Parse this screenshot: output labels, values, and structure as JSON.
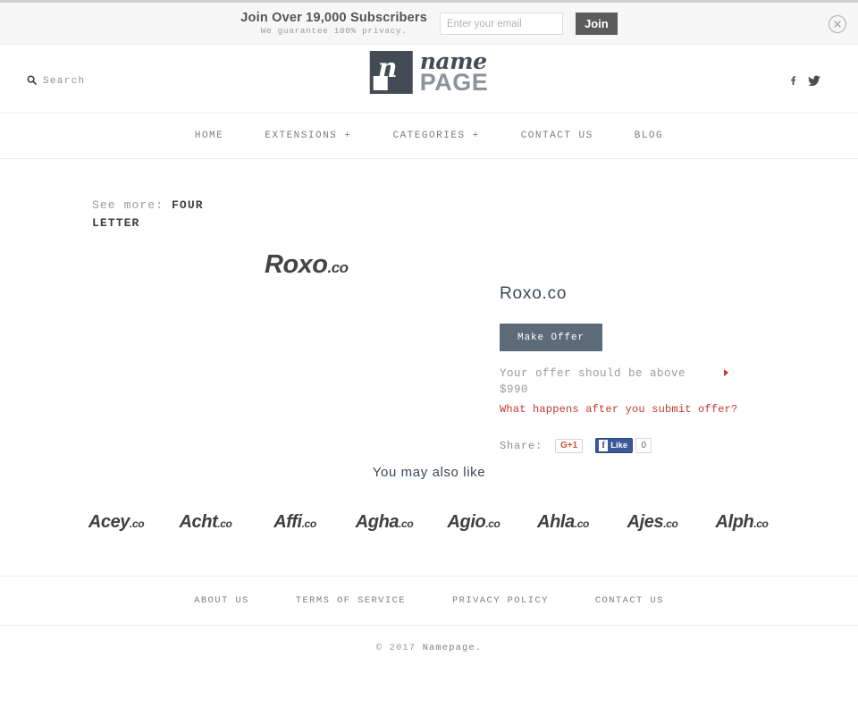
{
  "topbar": {
    "headline": "Join Over 19,000 Subscribers",
    "subline": "We guarantee 100% privacy.",
    "email_placeholder": "Enter your email",
    "email_value": "",
    "join_label": "Join",
    "close_icon": "close-circle-icon"
  },
  "header": {
    "search_label": "Search",
    "search_icon": "search-icon",
    "logo": {
      "mark_letter": "n",
      "name": "name",
      "page": "PAGE"
    },
    "social": [
      {
        "name": "facebook-icon",
        "label": "f"
      },
      {
        "name": "twitter-icon",
        "label": "t"
      }
    ]
  },
  "nav": {
    "items": [
      {
        "label": "HOME"
      },
      {
        "label": "EXTENSIONS +"
      },
      {
        "label": "CATEGORIES +"
      },
      {
        "label": "CONTACT US"
      },
      {
        "label": "BLOG"
      }
    ]
  },
  "breadcrumb": {
    "label": "See more:",
    "link": "FOUR LETTER"
  },
  "product": {
    "logo_name": "Roxo",
    "logo_tld": ".co",
    "title": "Roxo.co",
    "make_offer_label": "Make Offer",
    "offer_note": "Your offer should be above $990",
    "offer_minimum": "$990",
    "offer_link": "What happens after you submit offer?",
    "share_label": "Share:",
    "gplus_label": "G+1",
    "facebook_like_label": "Like",
    "facebook_count": "0"
  },
  "also_like": {
    "title": "You may also like",
    "items": [
      {
        "name": "Acey",
        "tld": ".co"
      },
      {
        "name": "Acht",
        "tld": ".co"
      },
      {
        "name": "Affi",
        "tld": ".co"
      },
      {
        "name": "Agha",
        "tld": ".co"
      },
      {
        "name": "Agio",
        "tld": ".co"
      },
      {
        "name": "Ahla",
        "tld": ".co"
      },
      {
        "name": "Ajes",
        "tld": ".co"
      },
      {
        "name": "Alph",
        "tld": ".co"
      }
    ]
  },
  "footer": {
    "links": [
      {
        "label": "ABOUT US"
      },
      {
        "label": "TERMS OF SERVICE"
      },
      {
        "label": "PRIVACY POLICY"
      },
      {
        "label": "CONTACT US"
      }
    ],
    "copyright_prefix": "© 2017 ",
    "copyright_brand": "Namepage."
  },
  "colors": {
    "accent_red": "#c0392b",
    "button_slate": "#5d6b78",
    "logo_dark": "#434b55",
    "facebook_blue": "#3b5998",
    "gplus_red": "#dd4b39"
  }
}
